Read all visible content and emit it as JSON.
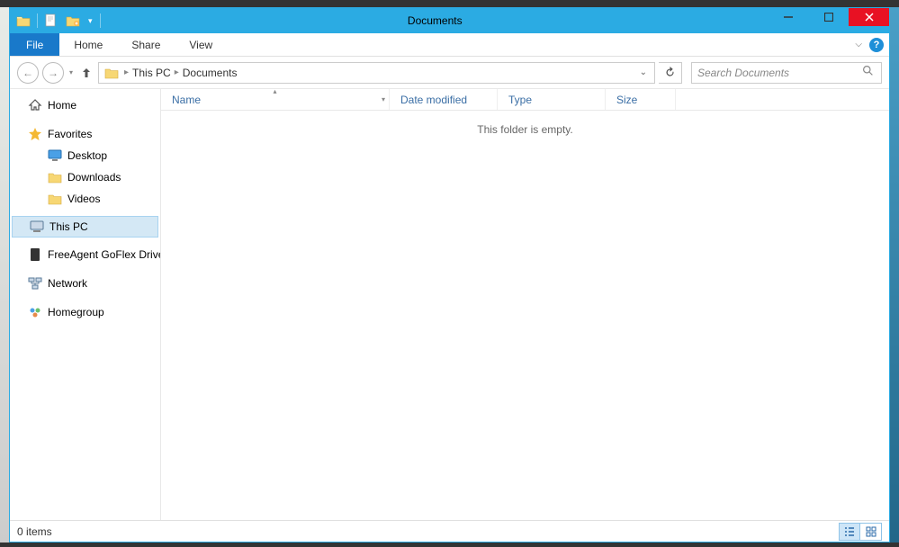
{
  "window": {
    "title": "Documents"
  },
  "ribbon": {
    "file": "File",
    "tabs": [
      "Home",
      "Share",
      "View"
    ]
  },
  "breadcrumb": {
    "root": "This PC",
    "current": "Documents"
  },
  "search": {
    "placeholder": "Search Documents"
  },
  "navpane": {
    "home": "Home",
    "favorites": "Favorites",
    "fav_items": [
      "Desktop",
      "Downloads",
      "Videos"
    ],
    "this_pc": "This PC",
    "drive": "FreeAgent GoFlex Drive",
    "network": "Network",
    "homegroup": "Homegroup"
  },
  "columns": {
    "name": "Name",
    "date": "Date modified",
    "type": "Type",
    "size": "Size"
  },
  "content": {
    "empty_message": "This folder is empty."
  },
  "statusbar": {
    "item_count": "0 items"
  }
}
